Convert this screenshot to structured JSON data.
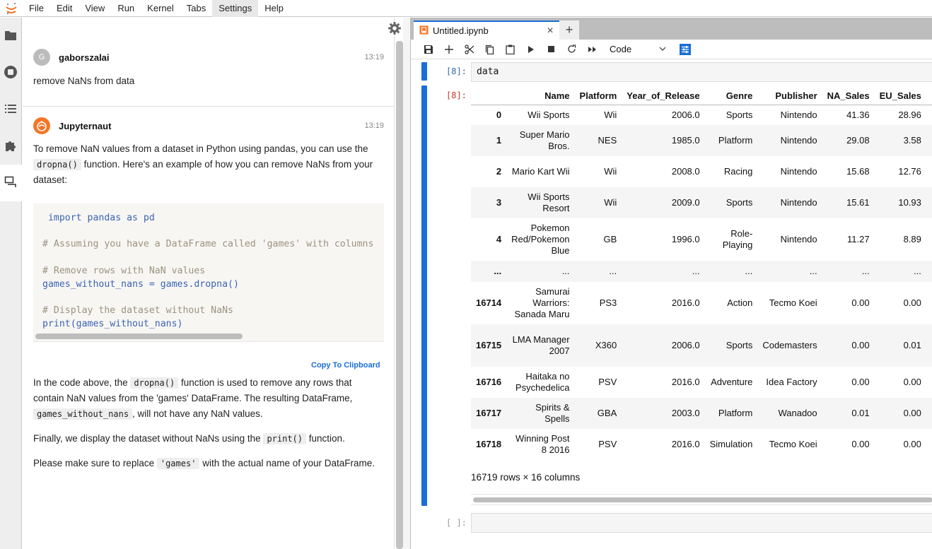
{
  "menubar": {
    "items": [
      "File",
      "Edit",
      "View",
      "Run",
      "Kernel",
      "Tabs",
      "Settings",
      "Help"
    ],
    "active": "Settings"
  },
  "leftbar": {
    "icons": [
      "folder-icon",
      "running-icon",
      "toc-icon",
      "extension-icon",
      "chat-icon"
    ]
  },
  "chat": {
    "messages": [
      {
        "user": "gaborszalai",
        "avatar_letter": "G",
        "time": "13:19",
        "text": "remove NaNs from data"
      },
      {
        "user": "Jupyternaut",
        "time": "13:19",
        "p1_a": "To remove NaN values from a dataset in Python using pandas, you can use the",
        "p1_code": "dropna()",
        "p1_b": "function. Here's an example of how you can remove NaNs from your dataset:",
        "code_lines": [
          {
            "t": " import pandas as pd",
            "c": false
          },
          {
            "t": "",
            "c": false
          },
          {
            "t": "# Assuming you have a DataFrame called 'games' with columns",
            "c": true
          },
          {
            "t": "",
            "c": false
          },
          {
            "t": "# Remove rows with NaN values",
            "c": true
          },
          {
            "t": "games_without_nans = games.dropna()",
            "c": false
          },
          {
            "t": "",
            "c": false
          },
          {
            "t": "# Display the dataset without NaNs",
            "c": true
          },
          {
            "t": "print(games_without_nans)",
            "c": false
          }
        ],
        "copy_label": "Copy To Clipboard",
        "p2_a": "In the code above, the",
        "p2_code1": "dropna()",
        "p2_b": "function is used to remove any rows that contain NaN values from the 'games' DataFrame. The resulting DataFrame,",
        "p2_code2": "games_without_nans",
        "p2_c": ", will not have any NaN values.",
        "p3_a": "Finally, we display the dataset without NaNs using the",
        "p3_code": "print()",
        "p3_b": "function.",
        "p4_a": "Please make sure to replace",
        "p4_code": "'games'",
        "p4_b": "with the actual name of your DataFrame."
      }
    ]
  },
  "notebook": {
    "tab_label": "Untitled.ipynb",
    "new_tab": "+",
    "close": "×",
    "cell_type": "Code",
    "cells": [
      {
        "in_prompt": "[8]:",
        "source": "data",
        "out_prompt": "[8]:"
      },
      {
        "in_prompt": "[ ]:",
        "source": ""
      }
    ],
    "dataframe": {
      "columns": [
        "",
        "Name",
        "Platform",
        "Year_of_Release",
        "Genre",
        "Publisher",
        "NA_Sales",
        "EU_Sales",
        "…"
      ],
      "rows": [
        [
          "0",
          "Wii Sports",
          "Wii",
          "2006.0",
          "Sports",
          "Nintendo",
          "41.36",
          "28.96"
        ],
        [
          "1",
          "Super Mario Bros.",
          "NES",
          "1985.0",
          "Platform",
          "Nintendo",
          "29.08",
          "3.58"
        ],
        [
          "2",
          "Mario Kart Wii",
          "Wii",
          "2008.0",
          "Racing",
          "Nintendo",
          "15.68",
          "12.76"
        ],
        [
          "3",
          "Wii Sports Resort",
          "Wii",
          "2009.0",
          "Sports",
          "Nintendo",
          "15.61",
          "10.93"
        ],
        [
          "4",
          "Pokemon Red/Pokemon Blue",
          "GB",
          "1996.0",
          "Role-Playing",
          "Nintendo",
          "11.27",
          "8.89"
        ],
        [
          "...",
          "...",
          "...",
          "...",
          "...",
          "...",
          "...",
          "..."
        ],
        [
          "16714",
          "Samurai Warriors: Sanada Maru",
          "PS3",
          "2016.0",
          "Action",
          "Tecmo Koei",
          "0.00",
          "0.00"
        ],
        [
          "16715",
          "LMA Manager 2007",
          "X360",
          "2006.0",
          "Sports",
          "Codemasters",
          "0.00",
          "0.01"
        ],
        [
          "16716",
          "Haitaka no Psychedelica",
          "PSV",
          "2016.0",
          "Adventure",
          "Idea Factory",
          "0.00",
          "0.00"
        ],
        [
          "16717",
          "Spirits & Spells",
          "GBA",
          "2003.0",
          "Platform",
          "Wanadoo",
          "0.01",
          "0.00"
        ],
        [
          "16718",
          "Winning Post 8 2016",
          "PSV",
          "2016.0",
          "Simulation",
          "Tecmo Koei",
          "0.00",
          "0.00"
        ]
      ],
      "shape_text": "16719 rows × 16 columns"
    }
  },
  "colors": {
    "accent": "#1a6ed8",
    "jupyternaut": "#f37626",
    "in_prompt": "#3068b0",
    "out_prompt": "#c0392b"
  }
}
